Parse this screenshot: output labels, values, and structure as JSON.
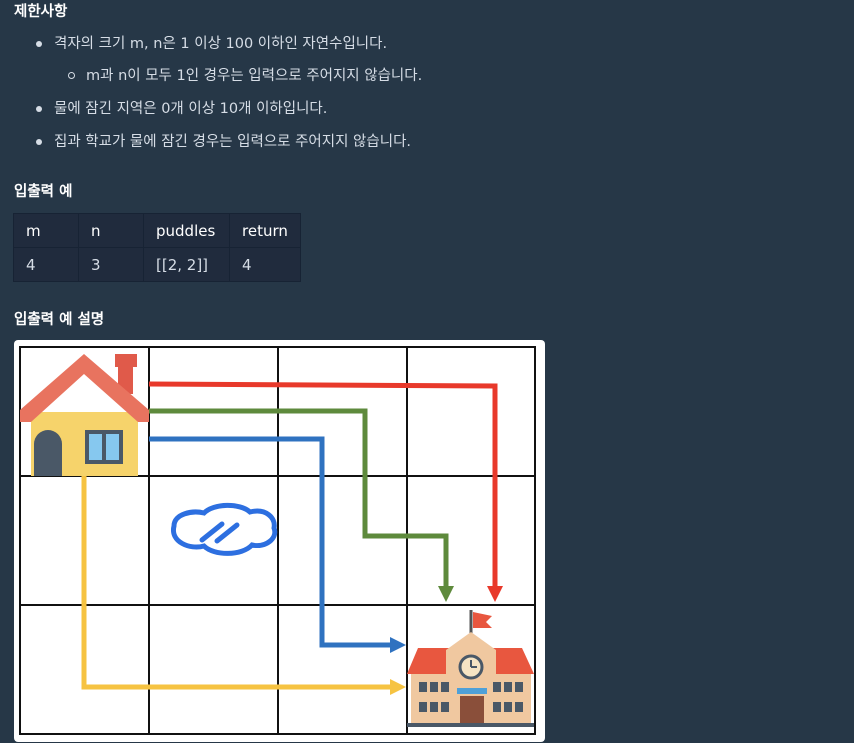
{
  "constraints": {
    "heading": "제한사항",
    "items": [
      "격자의 크기 m, n은 1 이상 100 이하인 자연수입니다.",
      "m과 n이 모두 1인 경우는 입력으로 주어지지 않습니다.",
      "물에 잠긴 지역은 0개 이상 10개 이하입니다.",
      "집과 학교가 물에 잠긴 경우는 입력으로 주어지지 않습니다."
    ]
  },
  "example": {
    "heading": "입출력 예",
    "columns": [
      "m",
      "n",
      "puddles",
      "return"
    ],
    "rows": [
      [
        "4",
        "3",
        "[[2, 2]]",
        "4"
      ]
    ]
  },
  "explanation": {
    "heading": "입출력 예 설명"
  },
  "figure_colors": {
    "red_path": "#e8392b",
    "green_path": "#5e8a3c",
    "blue_path": "#2f72c0",
    "yellow_path": "#f6c342",
    "puddle": "#2d6fe0"
  }
}
